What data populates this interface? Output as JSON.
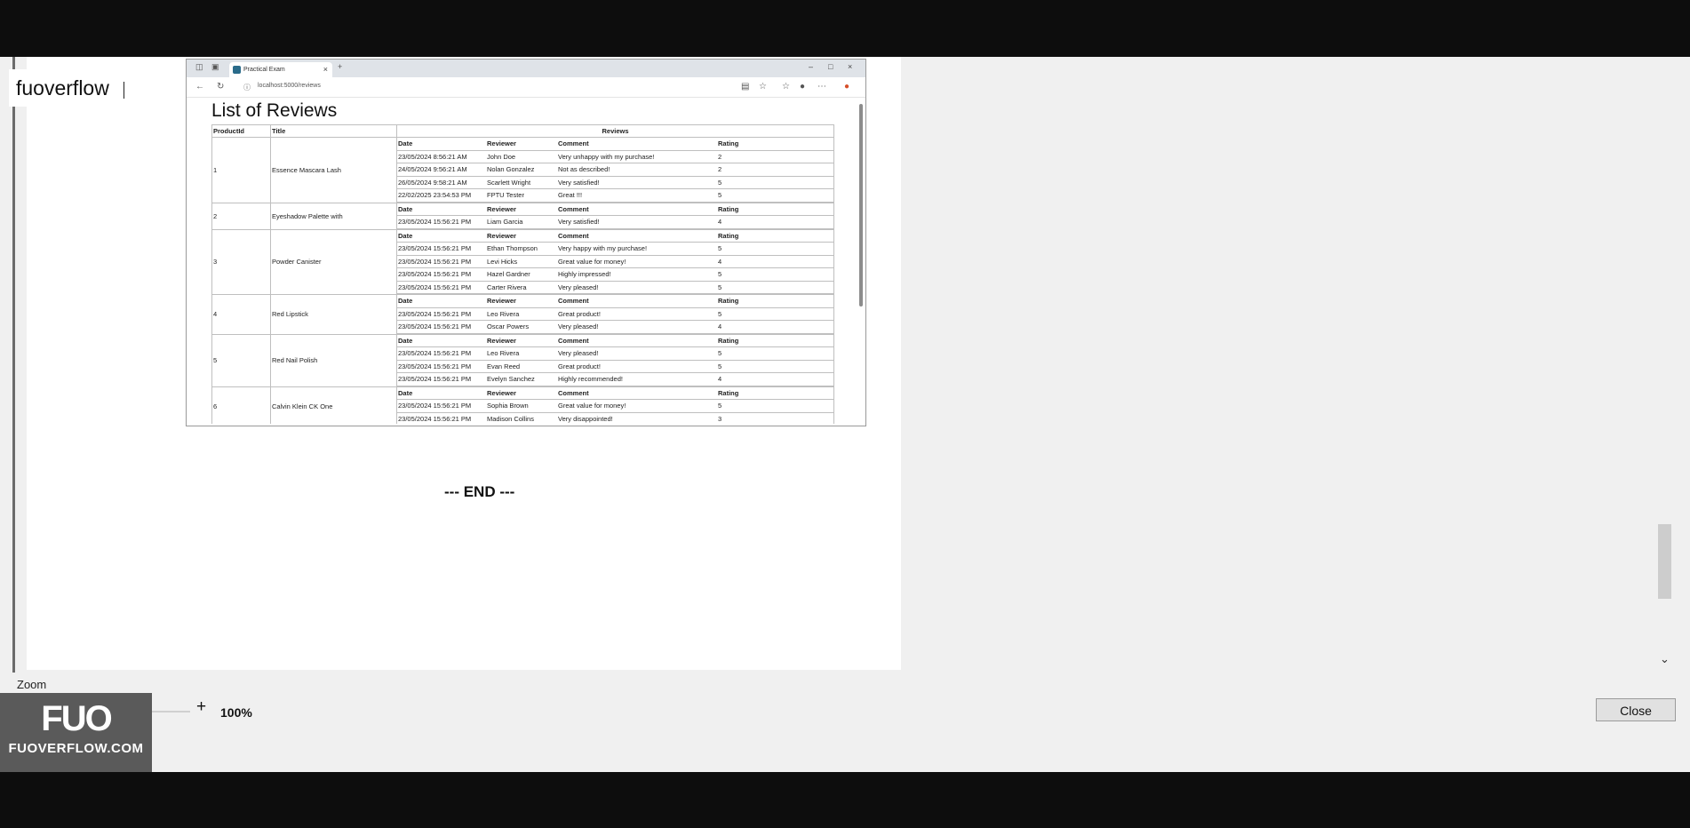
{
  "watermark": {
    "text": "fuoverflow"
  },
  "browser": {
    "tab_title": "Practical Exam",
    "url": "localhost:5000/reviews"
  },
  "page": {
    "title": "List of Reviews",
    "headers": {
      "product_id": "ProductId",
      "title": "Title",
      "reviews": "Reviews"
    },
    "subheaders": {
      "date": "Date",
      "reviewer": "Reviewer",
      "comment": "Comment",
      "rating": "Rating"
    },
    "products": [
      {
        "id": "1",
        "title": "Essence Mascara Lash",
        "reviews": [
          {
            "date": "23/05/2024 8:56:21 AM",
            "reviewer": "John Doe",
            "comment": "Very unhappy with my purchase!",
            "rating": "2"
          },
          {
            "date": "24/05/2024 9:56:21 AM",
            "reviewer": "Nolan Gonzalez",
            "comment": "Not as described!",
            "rating": "2"
          },
          {
            "date": "26/05/2024 9:58:21 AM",
            "reviewer": "Scarlett Wright",
            "comment": "Very satisfied!",
            "rating": "5"
          },
          {
            "date": "22/02/2025 23:54:53 PM",
            "reviewer": "FPTU Tester",
            "comment": "Great !!!",
            "rating": "5"
          }
        ]
      },
      {
        "id": "2",
        "title": "Eyeshadow Palette with",
        "reviews": [
          {
            "date": "23/05/2024 15:56:21 PM",
            "reviewer": "Liam Garcia",
            "comment": "Very satisfied!",
            "rating": "4"
          }
        ]
      },
      {
        "id": "3",
        "title": "Powder Canister",
        "reviews": [
          {
            "date": "23/05/2024 15:56:21 PM",
            "reviewer": "Ethan Thompson",
            "comment": "Very happy with my purchase!",
            "rating": "5"
          },
          {
            "date": "23/05/2024 15:56:21 PM",
            "reviewer": "Levi Hicks",
            "comment": "Great value for money!",
            "rating": "4"
          },
          {
            "date": "23/05/2024 15:56:21 PM",
            "reviewer": "Hazel Gardner",
            "comment": "Highly impressed!",
            "rating": "5"
          },
          {
            "date": "23/05/2024 15:56:21 PM",
            "reviewer": "Carter Rivera",
            "comment": "Very pleased!",
            "rating": "5"
          }
        ]
      },
      {
        "id": "4",
        "title": "Red Lipstick",
        "reviews": [
          {
            "date": "23/05/2024 15:56:21 PM",
            "reviewer": "Leo Rivera",
            "comment": "Great product!",
            "rating": "5"
          },
          {
            "date": "23/05/2024 15:56:21 PM",
            "reviewer": "Oscar Powers",
            "comment": "Very pleased!",
            "rating": "4"
          }
        ]
      },
      {
        "id": "5",
        "title": "Red Nail Polish",
        "reviews": [
          {
            "date": "23/05/2024 15:56:21 PM",
            "reviewer": "Leo Rivera",
            "comment": "Very pleased!",
            "rating": "5"
          },
          {
            "date": "23/05/2024 15:56:21 PM",
            "reviewer": "Evan Reed",
            "comment": "Great product!",
            "rating": "5"
          },
          {
            "date": "23/05/2024 15:56:21 PM",
            "reviewer": "Evelyn Sanchez",
            "comment": "Highly recommended!",
            "rating": "4"
          }
        ]
      },
      {
        "id": "6",
        "title": "Calvin Klein CK One",
        "reviews": [
          {
            "date": "23/05/2024 15:56:21 PM",
            "reviewer": "Sophia Brown",
            "comment": "Great value for money!",
            "rating": "5"
          },
          {
            "date": "23/05/2024 15:56:21 PM",
            "reviewer": "Madison Collins",
            "comment": "Very disappointed!",
            "rating": "3"
          }
        ]
      }
    ]
  },
  "document": {
    "end_text": "--- END ---"
  },
  "zoom": {
    "label": "Zoom",
    "minus": "-",
    "plus": "+",
    "value": "100%",
    "level_percent": 100
  },
  "dialog": {
    "close_label": "Close"
  },
  "logo": {
    "mark": "FUO",
    "sub": "FUOVERFLOW.COM"
  },
  "colors": {
    "accent": "#2b61b1",
    "background": "#f0f0f0",
    "page": "#ffffff",
    "letterbox": "#0d0d0d"
  }
}
